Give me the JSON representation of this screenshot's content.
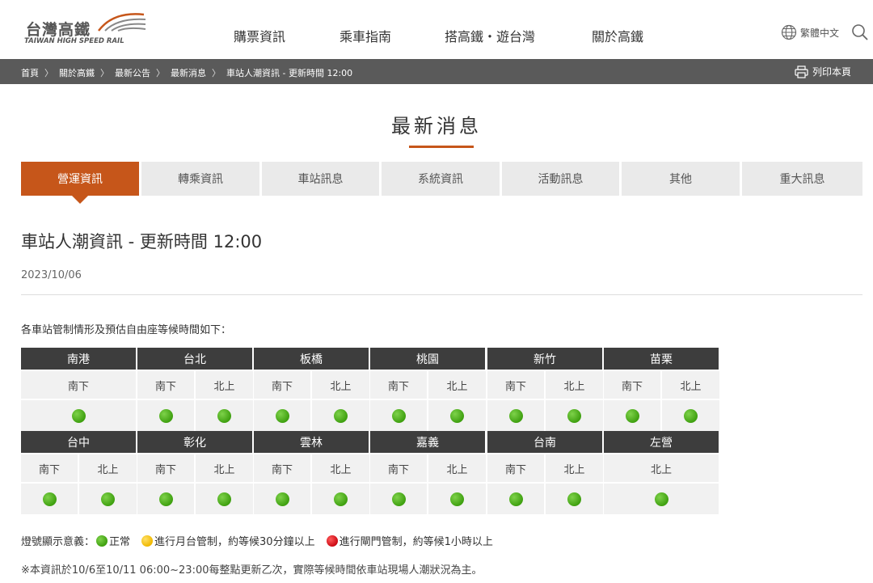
{
  "header": {
    "logo_cn": "台灣高鐵",
    "logo_en": "TAIWAN HIGH SPEED RAIL",
    "nav": [
      "購票資訊",
      "乘車指南",
      "搭高鐵・遊台灣",
      "關於高鐵"
    ],
    "language": "繁體中文",
    "icons": [
      "globe-icon",
      "search-icon"
    ]
  },
  "breadcrumb": [
    "首頁",
    "關於高鐵",
    "最新公告",
    "最新消息",
    "車站人潮資訊 - 更新時間 12:00"
  ],
  "print_label": "列印本頁",
  "page_title": "最新消息",
  "tabs": [
    {
      "label": "營運資訊",
      "active": true
    },
    {
      "label": "轉乘資訊",
      "active": false
    },
    {
      "label": "車站訊息",
      "active": false
    },
    {
      "label": "系統資訊",
      "active": false
    },
    {
      "label": "活動訊息",
      "active": false
    },
    {
      "label": "其他",
      "active": false
    },
    {
      "label": "重大訊息",
      "active": false
    }
  ],
  "article": {
    "title": "車站人潮資訊 - 更新時間 12:00",
    "date": "2023/10/06",
    "intro": "各車站管制情形及預估自由座等候時間如下："
  },
  "stations_row1": [
    {
      "name": "南港",
      "dirs": [
        {
          "label": "南下",
          "status": "green"
        }
      ]
    },
    {
      "name": "台北",
      "dirs": [
        {
          "label": "南下",
          "status": "green"
        },
        {
          "label": "北上",
          "status": "green"
        }
      ]
    },
    {
      "name": "板橋",
      "dirs": [
        {
          "label": "南下",
          "status": "green"
        },
        {
          "label": "北上",
          "status": "green"
        }
      ]
    },
    {
      "name": "桃園",
      "dirs": [
        {
          "label": "南下",
          "status": "green"
        },
        {
          "label": "北上",
          "status": "green"
        }
      ]
    },
    {
      "name": "新竹",
      "dirs": [
        {
          "label": "南下",
          "status": "green"
        },
        {
          "label": "北上",
          "status": "green"
        }
      ]
    },
    {
      "name": "苗栗",
      "dirs": [
        {
          "label": "南下",
          "status": "green"
        },
        {
          "label": "北上",
          "status": "green"
        }
      ]
    }
  ],
  "stations_row2": [
    {
      "name": "台中",
      "dirs": [
        {
          "label": "南下",
          "status": "green"
        },
        {
          "label": "北上",
          "status": "green"
        }
      ]
    },
    {
      "name": "彰化",
      "dirs": [
        {
          "label": "南下",
          "status": "green"
        },
        {
          "label": "北上",
          "status": "green"
        }
      ]
    },
    {
      "name": "雲林",
      "dirs": [
        {
          "label": "南下",
          "status": "green"
        },
        {
          "label": "北上",
          "status": "green"
        }
      ]
    },
    {
      "name": "嘉義",
      "dirs": [
        {
          "label": "南下",
          "status": "green"
        },
        {
          "label": "北上",
          "status": "green"
        }
      ]
    },
    {
      "name": "台南",
      "dirs": [
        {
          "label": "南下",
          "status": "green"
        },
        {
          "label": "北上",
          "status": "green"
        }
      ]
    },
    {
      "name": "左營",
      "dirs": [
        {
          "label": "北上",
          "status": "green"
        }
      ]
    }
  ],
  "legend": {
    "prefix": "燈號顯示意義：",
    "items": [
      {
        "color": "#45a81a",
        "label": "正常"
      },
      {
        "color": "#f2c21a",
        "label": "進行月台管制，約等候30分鐘以上"
      },
      {
        "color": "#d9141e",
        "label": "進行閘門管制，約等候1小時以上"
      }
    ]
  },
  "note": "※本資訊於10/6至10/11 06:00~23:00每整點更新乙次，實際等候時間依車站現場人潮狀況為主。",
  "colors": {
    "accent": "#c6561a",
    "header_dark": "#3d3d3d",
    "crumb_bar": "#5a5a5a",
    "status_green": "#45a81a"
  }
}
